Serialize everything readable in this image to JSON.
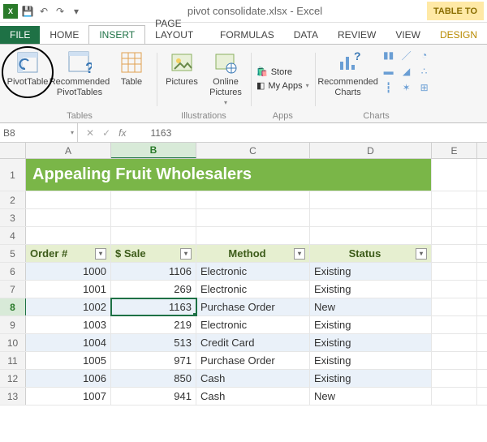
{
  "titlebar": {
    "file_title": "pivot consolidate.xlsx - Excel",
    "tool_tab_label": "TABLE TO"
  },
  "tabs": {
    "file": "FILE",
    "home": "HOME",
    "insert": "INSERT",
    "page_layout": "PAGE LAYOUT",
    "formulas": "FORMULAS",
    "data": "DATA",
    "review": "REVIEW",
    "view": "VIEW",
    "design": "DESIGN"
  },
  "ribbon": {
    "pivottable": "PivotTable",
    "rec_pivot": "Recommended PivotTables",
    "table": "Table",
    "tables_group": "Tables",
    "pictures": "Pictures",
    "online_pics": "Online Pictures",
    "illustrations_group": "Illustrations",
    "store": "Store",
    "my_apps": "My Apps",
    "apps_group": "Apps",
    "rec_charts": "Recommended Charts",
    "charts_group": "Charts"
  },
  "formula_bar": {
    "name_box": "B8",
    "value": "1163"
  },
  "sheet": {
    "columns": [
      "A",
      "B",
      "C",
      "D",
      "E"
    ],
    "row_labels": [
      "1",
      "2",
      "3",
      "4",
      "5",
      "6",
      "7",
      "8",
      "9",
      "10",
      "11",
      "12",
      "13"
    ],
    "title": "Appealing Fruit Wholesalers",
    "headers": {
      "order": "Order #",
      "sale": "$ Sale",
      "method": "Method",
      "status": "Status"
    },
    "data": [
      {
        "order": "1000",
        "sale": "1106",
        "method": "Electronic",
        "status": "Existing"
      },
      {
        "order": "1001",
        "sale": "269",
        "method": "Electronic",
        "status": "Existing"
      },
      {
        "order": "1002",
        "sale": "1163",
        "method": "Purchase Order",
        "status": "New"
      },
      {
        "order": "1003",
        "sale": "219",
        "method": "Electronic",
        "status": "Existing"
      },
      {
        "order": "1004",
        "sale": "513",
        "method": "Credit Card",
        "status": "Existing"
      },
      {
        "order": "1005",
        "sale": "971",
        "method": "Purchase Order",
        "status": "Existing"
      },
      {
        "order": "1006",
        "sale": "850",
        "method": "Cash",
        "status": "Existing"
      },
      {
        "order": "1007",
        "sale": "941",
        "method": "Cash",
        "status": "New"
      }
    ]
  }
}
